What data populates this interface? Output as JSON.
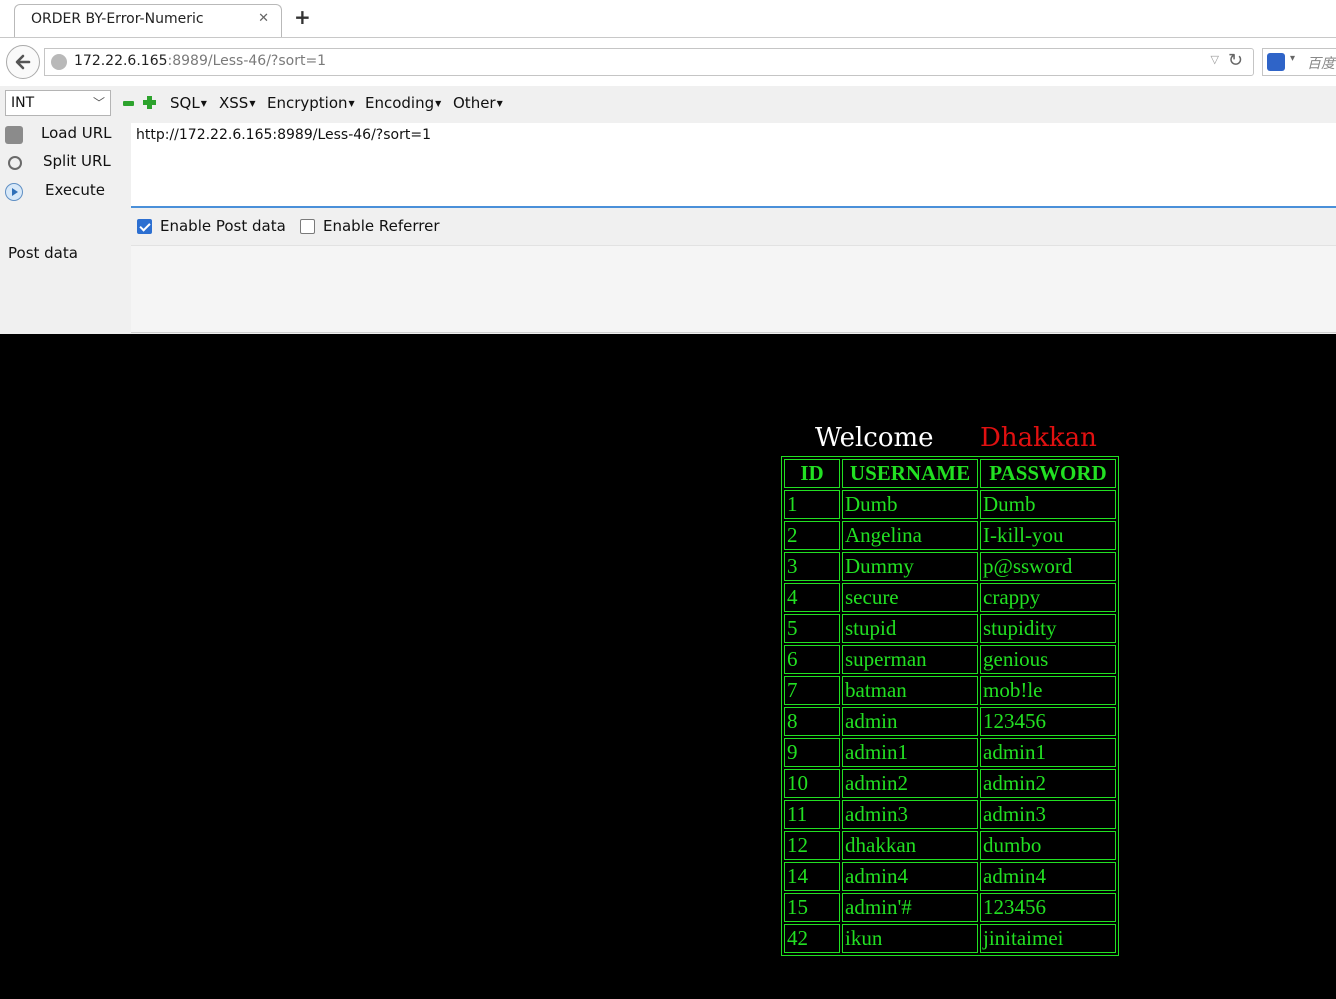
{
  "browser": {
    "tab_title": "ORDER BY-Error-Numeric",
    "tab_close": "✕",
    "new_tab": "+",
    "url_host": "172.22.6.165",
    "url_rest": ":8989/Less-46/?sort=1",
    "search_placeholder": "百度"
  },
  "hackbar": {
    "select_value": "INT",
    "menus": [
      "SQL",
      "XSS",
      "Encryption",
      "Encoding",
      "Other"
    ],
    "load_url": "Load URL",
    "split_url": "Split URL",
    "execute": "Execute",
    "url_value": "http://172.22.6.165:8989/Less-46/?sort=1",
    "enable_post": "Enable Post data",
    "enable_post_checked": true,
    "enable_referrer": "Enable Referrer",
    "enable_referrer_checked": false,
    "post_data_label": "Post data",
    "post_data_value": ""
  },
  "page": {
    "welcome": "Welcome",
    "user": "Dhakkan",
    "columns": [
      "ID",
      "USERNAME",
      "PASSWORD"
    ],
    "rows": [
      [
        "1",
        "Dumb",
        "Dumb"
      ],
      [
        "2",
        "Angelina",
        "I-kill-you"
      ],
      [
        "3",
        "Dummy",
        "p@ssword"
      ],
      [
        "4",
        "secure",
        "crappy"
      ],
      [
        "5",
        "stupid",
        "stupidity"
      ],
      [
        "6",
        "superman",
        "genious"
      ],
      [
        "7",
        "batman",
        "mob!le"
      ],
      [
        "8",
        "admin",
        "123456"
      ],
      [
        "9",
        "admin1",
        "admin1"
      ],
      [
        "10",
        "admin2",
        "admin2"
      ],
      [
        "11",
        "admin3",
        "admin3"
      ],
      [
        "12",
        "dhakkan",
        "dumbo"
      ],
      [
        "14",
        "admin4",
        "admin4"
      ],
      [
        "15",
        "admin'#",
        "123456"
      ],
      [
        "42",
        "ikun",
        "jinitaimei"
      ]
    ],
    "colors": {
      "table_text": "#22e022",
      "user_name": "#e01010",
      "background": "#000000"
    }
  }
}
